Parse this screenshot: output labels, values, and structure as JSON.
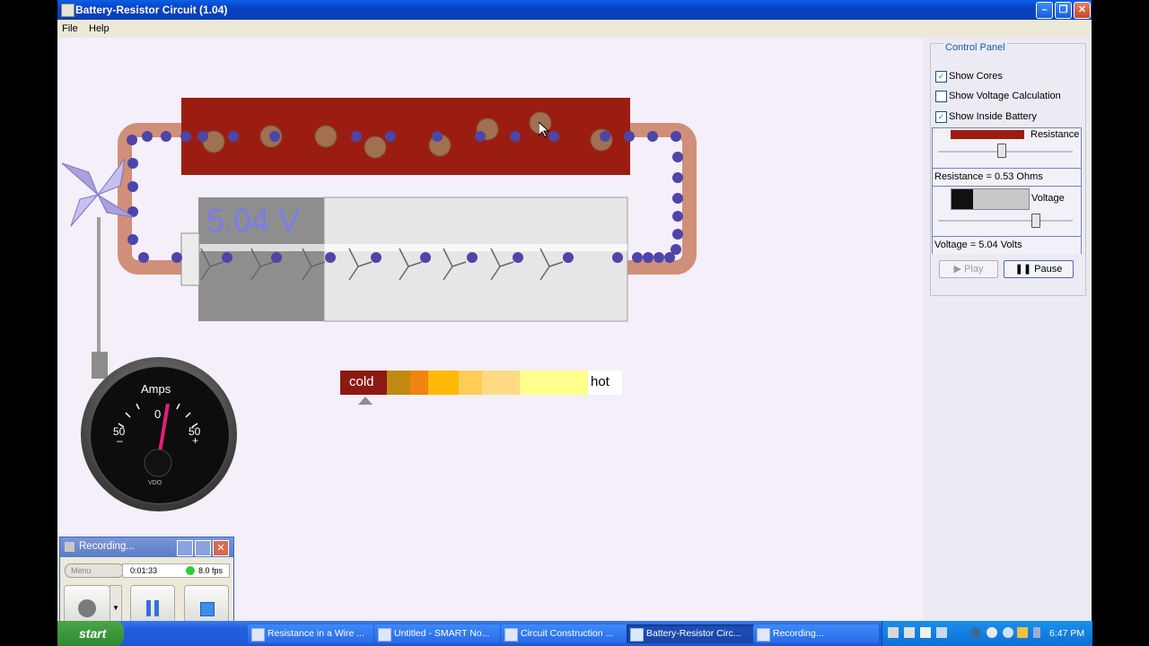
{
  "window": {
    "title": "Battery-Resistor Circuit (1.04)",
    "menu": [
      "File",
      "Help"
    ]
  },
  "simulation": {
    "battery_voltage_label": "5.04 V",
    "heat_scale": {
      "cold_label": "cold",
      "hot_label": "hot"
    },
    "ammeter": {
      "title": "Amps",
      "zero_label": "0",
      "left_label": "50",
      "right_label": "50",
      "minus_label": "–",
      "plus_label": "+",
      "brand": "VDO"
    }
  },
  "control_panel": {
    "title": "Control Panel",
    "checkboxes": [
      {
        "label": "Show Cores",
        "checked": true
      },
      {
        "label": "Show Voltage Calculation",
        "checked": false
      },
      {
        "label": "Show Inside Battery",
        "checked": true
      }
    ],
    "resistance": {
      "label": "Resistance",
      "readout": "Resistance = 0.53 Ohms"
    },
    "voltage": {
      "label": "Voltage",
      "readout": "Voltage = 5.04 Volts"
    },
    "play_label": "Play",
    "pause_label": "Pause"
  },
  "recorder": {
    "title": "Recording...",
    "menu_label": "Menu",
    "elapsed": "0:01:33",
    "fps": "8.0 fps"
  },
  "taskbar": {
    "start_label": "start",
    "tasks": [
      {
        "label": "Resistance in a Wire ...",
        "active": false
      },
      {
        "label": "Untitled - SMART No...",
        "active": false
      },
      {
        "label": "Circuit Construction ...",
        "active": false
      },
      {
        "label": "Battery-Resistor Circ...",
        "active": true
      },
      {
        "label": "Recording...",
        "active": false
      }
    ],
    "clock": "6:47 PM"
  },
  "colors": {
    "resistor": "#9b1d12",
    "wire": "#d08f78",
    "electron": "#4d45a8",
    "core": "#a07050",
    "accent": "#1f5aa8"
  }
}
